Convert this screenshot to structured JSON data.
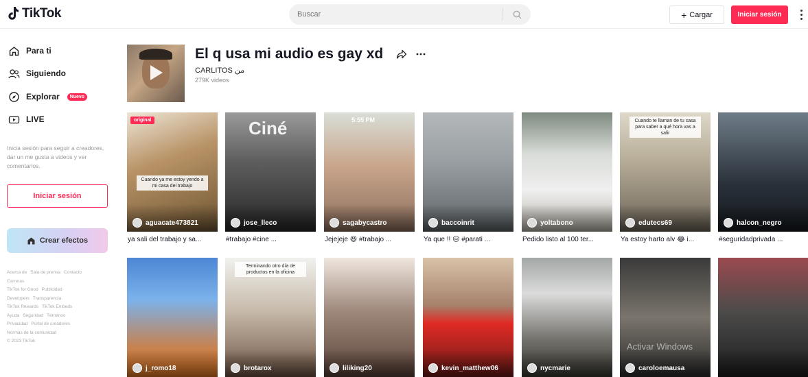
{
  "header": {
    "logo_text": "TikTok",
    "search_placeholder": "Buscar",
    "upload_label": "Cargar",
    "login_label": "Iniciar sesión"
  },
  "sidebar": {
    "nav": [
      {
        "label": "Para ti",
        "icon": "home-icon"
      },
      {
        "label": "Siguiendo",
        "icon": "following-icon"
      },
      {
        "label": "Explorar",
        "icon": "compass-icon",
        "badge": "Nuevo"
      },
      {
        "label": "LIVE",
        "icon": "live-icon"
      }
    ],
    "hint": "Inicia sesión para seguir a creadores, dar un me gusta a videos y ver comentarios.",
    "login_label": "Iniciar sesión",
    "effects_label": "Crear efectos",
    "footer_lines": [
      [
        "Acerca de",
        "Sala de prensa",
        "Contacto"
      ],
      [
        "Carreras"
      ],
      [
        "TikTok for Good",
        "Publicidad"
      ],
      [
        "Developers",
        "Transparencia"
      ],
      [
        "TikTok Rewards",
        "TikTok Embeds"
      ],
      [
        "Ayuda",
        "Seguridad",
        "Términos"
      ],
      [
        "Privacidad",
        "Portal de creadores"
      ],
      [
        "Normas de la comunidad"
      ],
      [
        "© 2023 TikTok"
      ]
    ]
  },
  "sound": {
    "title": "El q usa mi audio es gay xd",
    "author": "CARLITOS ﻣﻦ",
    "count": "279K videos"
  },
  "videos": [
    {
      "user": "aguacate473821",
      "caption": "ya sali del trabajo y sa...",
      "tag": "original",
      "bg": "bg1",
      "overlay": "Cuando ya me estoy yendo a mi casa del trabajo"
    },
    {
      "user": "jose_lleco",
      "caption": "#trabajo #cine ...",
      "bg": "bg2",
      "sign": "Ciné"
    },
    {
      "user": "sagabycastro",
      "caption": "Jejejeje 😆 #trabajo ...",
      "bg": "bg3",
      "time": "5:55 PM"
    },
    {
      "user": "baccoinrit",
      "caption": "Ya que !! 😑 #parati ...",
      "bg": "bg4"
    },
    {
      "user": "yoltabono",
      "caption": "Pedido listo al 100 ter...",
      "bg": "bg5"
    },
    {
      "user": "edutecs69",
      "caption": "Ya estoy harto alv 😂 i...",
      "bg": "bg6",
      "overlay": "Cuando te llaman de tu casa para saber a qué hora vas a salir"
    },
    {
      "user": "halcon_negro",
      "caption": "#seguridadprivada ...",
      "bg": "bg7"
    },
    {
      "user": "j_romo18",
      "caption": "",
      "bg": "bg8"
    },
    {
      "user": "brotarox",
      "caption": "",
      "bg": "bg9",
      "overlay": "Terminando otro día de productos en la oficina"
    },
    {
      "user": "liliking20",
      "caption": "",
      "bg": "bg10"
    },
    {
      "user": "kevin_matthew06",
      "caption": "",
      "bg": "bg11"
    },
    {
      "user": "nycmarie",
      "caption": "",
      "bg": "bg12"
    },
    {
      "user": "caroloemausa",
      "caption": "",
      "bg": "bg13",
      "watermark": "Activar Windows"
    },
    {
      "user": "",
      "caption": "",
      "bg": "bg14"
    }
  ],
  "colors": {
    "accent": "#fe2c55",
    "text": "#161823"
  }
}
